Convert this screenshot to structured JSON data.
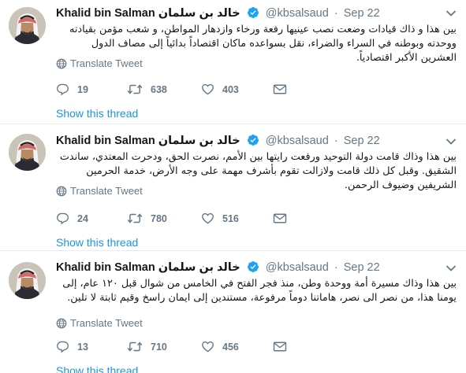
{
  "colors": {
    "link": "#1b95e0",
    "meta": "#657786",
    "verified": "#1da1f2",
    "border": "#e6ecf0"
  },
  "tweets": [
    {
      "name": "Khalid bin Salman",
      "name_ar": "خالد بن سلمان",
      "handle": "@kbsalsaud",
      "separator": "·",
      "date": "Sep 22",
      "text": "بين هذا و ذاك قيادات وضعت نصب عينيها رفعة ورخاء وازدهار المواطن، و شعب مؤمن بقيادته ووحدته وبوطنه في السراء والضراء، نقل بسواعده ماكان اقتصاداً بدائياً إلى مصاف الدول العشرين الأكبر اقتصادياً.",
      "translate_label": "Translate Tweet",
      "replies": "19",
      "retweets": "638",
      "likes": "403",
      "show_thread": "Show this thread",
      "icons": [
        "verified-icon",
        "caret-down-icon",
        "globe-icon",
        "reply-icon",
        "retweet-icon",
        "heart-icon",
        "envelope-icon"
      ]
    },
    {
      "name": "Khalid bin Salman",
      "name_ar": "خالد بن سلمان",
      "handle": "@kbsalsaud",
      "separator": "·",
      "date": "Sep 22",
      "text": "بين هذا وذاك قامت دولة التوحيد ورفعت رايتها بين الأمم، نصرت الحق، ودحرت المعتدي، ساندت الشقيق. وقبل كل ذلك قامت ولازالت تقوم بأشرف مهمة على وجه الأرض، خدمة الحرمين الشريفين وضيوف الرحمن.",
      "translate_label": "Translate Tweet",
      "replies": "24",
      "retweets": "780",
      "likes": "516",
      "show_thread": "Show this thread"
    },
    {
      "name": "Khalid bin Salman",
      "name_ar": "خالد بن سلمان",
      "handle": "@kbsalsaud",
      "separator": "·",
      "date": "Sep 22",
      "text": "بين هذا وذاك مسيرة أمة ووحدة وطن، منذ فجر الفتح في الخامس من شوال قبل ١٢٠ عام، إلى يومنا هذا، من نصر الى نصر، هاماتنا دوماً مرفوعة، مستندين إلى ايمان راسخ وقيم ثابتة لا تلين.",
      "translate_label": "Translate Tweet",
      "replies": "13",
      "retweets": "710",
      "likes": "456",
      "show_thread": "Show this thread"
    }
  ]
}
